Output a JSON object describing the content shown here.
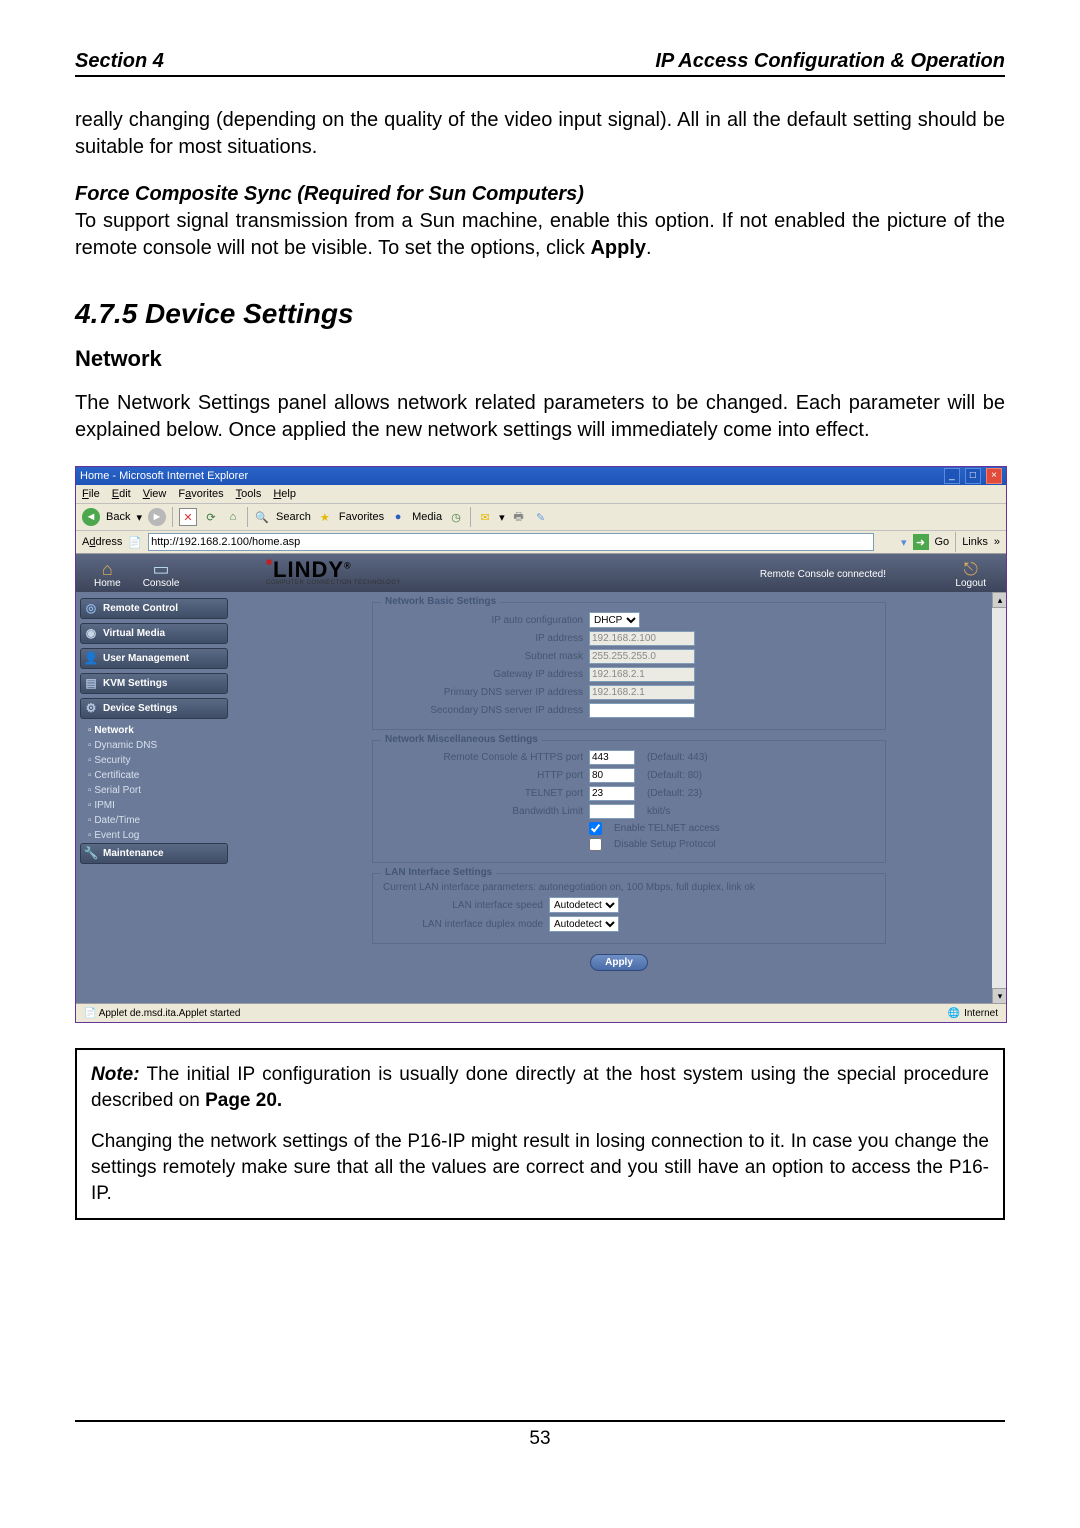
{
  "header": {
    "left": "Section 4",
    "right": "IP Access Configuration & Operation"
  },
  "intro_text": "really changing (depending on the quality of the video input signal). All in all the default setting should be suitable for most situations.",
  "force_sync": {
    "title": "Force Composite Sync (Required for Sun Computers)",
    "body": "To support signal transmission from a Sun machine, enable this option. If not enabled the picture of the remote console will not be visible. To set the options, click ",
    "apply": "Apply",
    "period": "."
  },
  "section_num": "4.7.5  Device Settings",
  "subsection": "Network",
  "network_text": "The Network Settings panel allows network related parameters to be changed.  Each parameter will be explained below. Once applied the new network settings will immediately come into effect.",
  "ie": {
    "title": "Home - Microsoft Internet Explorer",
    "menus": {
      "file": "File",
      "edit": "Edit",
      "view": "View",
      "favorites": "Favorites",
      "tools": "Tools",
      "help": "Help"
    },
    "toolbar": {
      "back": "Back",
      "search": "Search",
      "favorites": "Favorites",
      "media": "Media"
    },
    "address_label": "Address",
    "address_value": "http://192.168.2.100/home.asp",
    "go": "Go",
    "links": "Links",
    "lindy": {
      "home": "Home",
      "console": "Console",
      "status": "Remote Console connected!",
      "logout": "Logout",
      "logo": "LINDY",
      "logo_sub": "COMPUTER CONNECTION TECHNOLOGY"
    },
    "sidebar": {
      "remote": "Remote Control",
      "virtual": "Virtual Media",
      "user": "User Management",
      "kvm": "KVM Settings",
      "device": "Device Settings",
      "subs": {
        "network": "Network",
        "ddns": "Dynamic DNS",
        "security": "Security",
        "cert": "Certificate",
        "serial": "Serial Port",
        "ipmi": "IPMI",
        "datetime": "Date/Time",
        "eventlog": "Event Log"
      },
      "maint": "Maintenance"
    },
    "basic": {
      "legend": "Network Basic Settings",
      "ipauto": "IP auto configuration",
      "ipauto_val": "DHCP",
      "ipaddr": "IP address",
      "ipaddr_val": "192.168.2.100",
      "subnet": "Subnet mask",
      "subnet_val": "255.255.255.0",
      "gateway": "Gateway IP address",
      "gateway_val": "192.168.2.1",
      "pdns": "Primary DNS server IP address",
      "pdns_val": "192.168.2.1",
      "sdns": "Secondary DNS server IP address",
      "sdns_val": ""
    },
    "misc": {
      "legend": "Network Miscellaneous Settings",
      "https": "Remote Console & HTTPS port",
      "https_val": "443",
      "https_hint": "(Default: 443)",
      "http": "HTTP port",
      "http_val": "80",
      "http_hint": "(Default: 80)",
      "telnet": "TELNET port",
      "telnet_val": "23",
      "telnet_hint": "(Default: 23)",
      "bw": "Bandwidth Limit",
      "bw_val": "",
      "bw_hint": "kbit/s",
      "en_telnet": "Enable TELNET access",
      "dis_setup": "Disable Setup Protocol"
    },
    "lan": {
      "legend": "LAN Interface Settings",
      "current": "Current LAN interface parameters:  autonegotiation on, 100 Mbps, full duplex, link ok",
      "speed": "LAN interface speed",
      "speed_val": "Autodetect",
      "duplex": "LAN interface duplex mode",
      "duplex_val": "Autodetect"
    },
    "apply": "Apply",
    "status_left": "Applet de.msd.ita.Applet started",
    "status_right": "Internet"
  },
  "note": {
    "label": "Note:",
    "p1": " The initial IP configuration is usually done directly at the host system using the special procedure described on ",
    "page20": "Page 20.",
    "p2": "Changing the network settings of the P16-IP might result in losing connection to it. In case you change the settings remotely make sure that all the values are correct and you still have an option to access the P16-IP."
  },
  "page_num": "53"
}
